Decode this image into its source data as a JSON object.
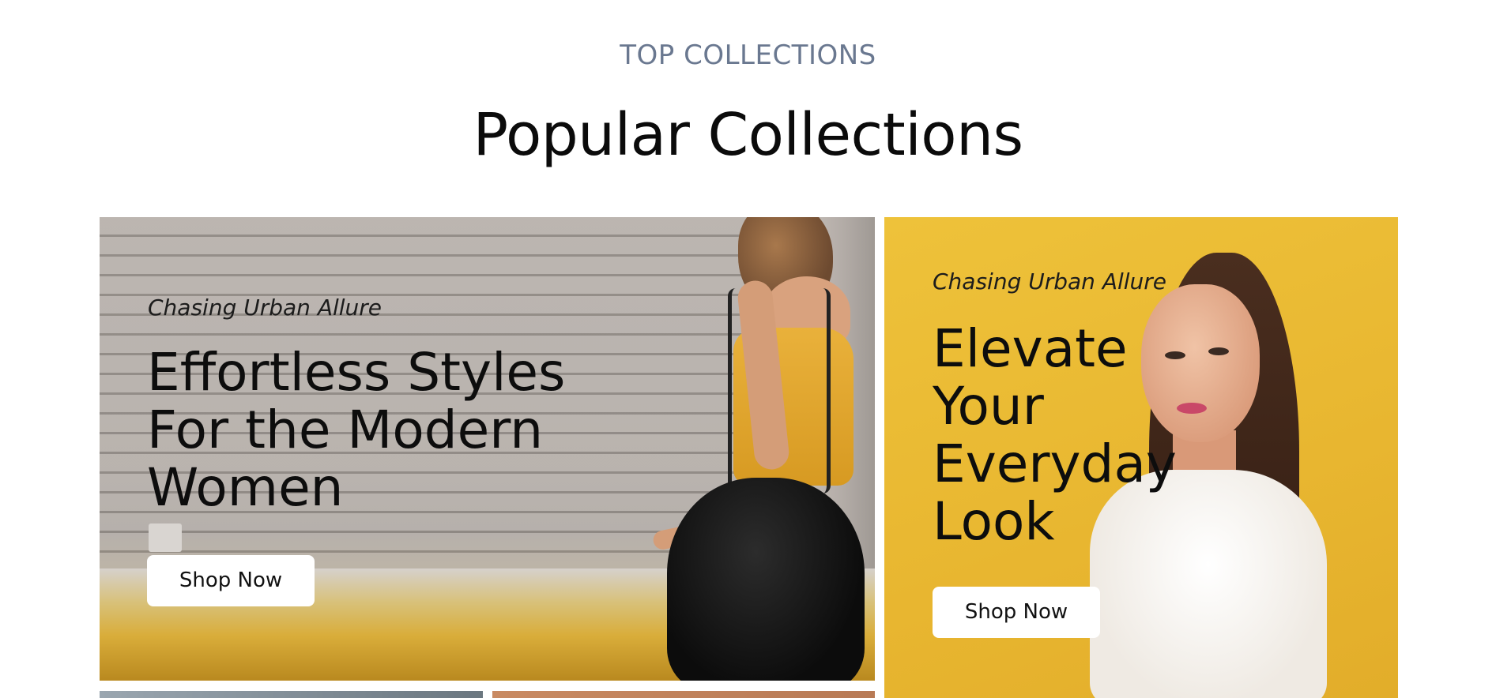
{
  "section": {
    "eyebrow": "TOP COLLECTIONS",
    "title": "Popular Collections"
  },
  "cards": [
    {
      "eyebrow": "Chasing Urban Allure",
      "title": "Effortless Styles For the Modern Women",
      "button_label": "Shop Now",
      "background_color": "#a49e99"
    },
    {
      "eyebrow": "Chasing Urban Allure",
      "title": "Elevate Your Everyday Look",
      "button_label": "Shop Now",
      "background_color": "#e8b630"
    }
  ],
  "colors": {
    "eyebrow": "#6a7890",
    "heading": "#0b0b0b",
    "button_bg": "#ffffff"
  }
}
